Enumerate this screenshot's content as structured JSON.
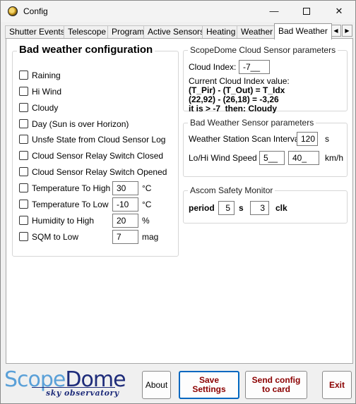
{
  "window": {
    "title": "Config",
    "minimize": "—",
    "close": "✕"
  },
  "tabs": [
    {
      "label": "Shutter Events"
    },
    {
      "label": "Telescope"
    },
    {
      "label": "Program"
    },
    {
      "label": "Active Sensors"
    },
    {
      "label": "Heating"
    },
    {
      "label": "Weather"
    },
    {
      "label": "Bad Weather"
    }
  ],
  "tab_scroll": {
    "left": "◀",
    "right": "▶"
  },
  "bad_weather": {
    "title": "Bad weather configuration",
    "conditions": [
      {
        "label": "Raining",
        "checked": false
      },
      {
        "label": "Hi Wind",
        "checked": false
      },
      {
        "label": "Cloudy",
        "checked": false
      },
      {
        "label": "Day (Sun is over Horizon)",
        "checked": false
      },
      {
        "label": "Unsfe State from Cloud Sensor Log",
        "checked": false
      },
      {
        "label": "Cloud Sensor Relay Switch Closed",
        "checked": false
      },
      {
        "label": "Cloud Sensor Relay Switch Opened",
        "checked": false
      }
    ],
    "thresholds": [
      {
        "label": "Temperature To High",
        "value": "30",
        "unit": "°C"
      },
      {
        "label": "Temperature To Low",
        "value": "-10",
        "unit": "°C"
      },
      {
        "label": "Humidity to High",
        "value": "20",
        "unit": "%"
      },
      {
        "label": "SQM to Low",
        "value": "7",
        "unit": "mag"
      }
    ]
  },
  "cloud_sensor": {
    "title": "ScopeDome Cloud Sensor parameters",
    "cloud_index_label": "Cloud Index:",
    "cloud_index_value": "-7__",
    "current_label": "Current Cloud Index value:",
    "formula_line1": "(T_Pir) - (T_Out) = T_Idx",
    "formula_line2": "(22,92) - (26,18) = -3,26",
    "formula_line3": "it is > -7  then: Cloudy"
  },
  "weather_sensor": {
    "title": "Bad Weather Sensor parameters",
    "scan_label": "Weather Station Scan Interval",
    "scan_value": "120",
    "scan_unit": "s",
    "wind_label": "Lo/Hi Wind Speed",
    "wind_lo": "5__",
    "wind_hi": "40_",
    "wind_unit": "km/h"
  },
  "ascom": {
    "title": "Ascom Safety Monitor",
    "period_label": "period",
    "period_value": "5",
    "period_unit": "s",
    "clk_value": "3",
    "clk_label": "clk"
  },
  "footer": {
    "logo_scope": "Scope",
    "logo_dome": "Dome",
    "logo_sub": "sky observatory",
    "about": "About",
    "save": "Save\nSettings",
    "send": "Send config\nto card",
    "exit": "Exit"
  }
}
